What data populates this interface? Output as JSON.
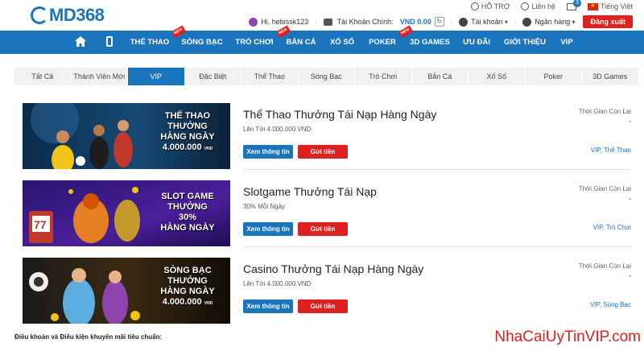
{
  "header": {
    "logo_text": "MD368",
    "support_label": "HỖ TRỢ",
    "contact_label": "Liên hệ",
    "mail_count": "3",
    "language_label": "Tiếng Việt",
    "greeting": "Hi, hebissk123",
    "main_account_label": "Tài Khoản Chính:",
    "balance": "VND 0.00",
    "account_menu_label": "Tài khoản",
    "bank_menu_label": "Ngân hàng",
    "logout_label": "Đăng xuất"
  },
  "nav": {
    "items": [
      {
        "label": "THỂ THAO",
        "new": false
      },
      {
        "label": "SÒNG BẠC",
        "new": true
      },
      {
        "label": "TRÒ CHƠI",
        "new": false
      },
      {
        "label": "BẮN CÁ",
        "new": true
      },
      {
        "label": "XỔ SỐ",
        "new": false
      },
      {
        "label": "POKER",
        "new": false
      },
      {
        "label": "3D GAMES",
        "new": true
      },
      {
        "label": "ƯU ĐÃI",
        "new": false
      },
      {
        "label": "GIỚI THIỆU",
        "new": false
      },
      {
        "label": "VIP",
        "new": false
      }
    ],
    "new_badge": "NEW"
  },
  "tabs": [
    "Tất Cả",
    "Thành Viên Mới",
    "VIP",
    "Đặc Biệt",
    "Thể Thao",
    "Sòng Bạc",
    "Trò Chơi",
    "Bắn Cá",
    "Xổ Số",
    "Poker",
    "3D Games"
  ],
  "active_tab": "VIP",
  "promos": [
    {
      "banner_lines": [
        "THỂ THAO",
        "THƯỞNG",
        "HÀNG NGÀY",
        "4.000.000"
      ],
      "banner_unit": "VND",
      "title": "Thể Thao Thưởng Tái Nạp Hàng Ngày",
      "subtitle": "Lên Tới 4.000.000 VND",
      "info_label": "Xem thông tin",
      "deposit_label": "Gửi tiền",
      "time_left_label": "Thời Gian Còn Lại",
      "time_left_value": "-",
      "tags": "VIP, Thể Thao"
    },
    {
      "banner_lines": [
        "SLOT GAME",
        "THƯỞNG",
        "30%",
        "HÀNG NGÀY"
      ],
      "banner_unit": "",
      "title": "Slotgame Thưởng Tái Nạp",
      "subtitle": "30% Mỗi Ngày",
      "info_label": "Xem thông tin",
      "deposit_label": "Gửi tiền",
      "time_left_label": "Thời Gian Còn Lại",
      "time_left_value": "-",
      "tags": "VIP, Trò Chơi"
    },
    {
      "banner_lines": [
        "SÒNG BẠC",
        "THƯỞNG",
        "HÀNG NGÀY",
        "4.000.000"
      ],
      "banner_unit": "VND",
      "title": "Casino Thưởng Tái Nạp Hàng Ngày",
      "subtitle": "Lên Tới 4.000.000 VND",
      "info_label": "Xem thông tin",
      "deposit_label": "Gửi tiền",
      "time_left_label": "Thời Gian Còn Lại",
      "time_left_value": "-",
      "tags": "VIP, Sòng Bạc"
    }
  ],
  "terms_label": "Điều khoản và Điều kiện khuyến mãi tiêu chuẩn:",
  "watermark": "NhaCaiUyTinVIP.com",
  "colors": {
    "brand_blue": "#1b75bc",
    "accent_red": "#e0201f"
  },
  "icons": [
    "home-icon",
    "mobile-icon",
    "support-icon",
    "contact-icon",
    "mail-icon",
    "flag-icon",
    "avatar-icon",
    "wallet-icon",
    "refresh-icon",
    "user-icon",
    "bank-icon"
  ]
}
